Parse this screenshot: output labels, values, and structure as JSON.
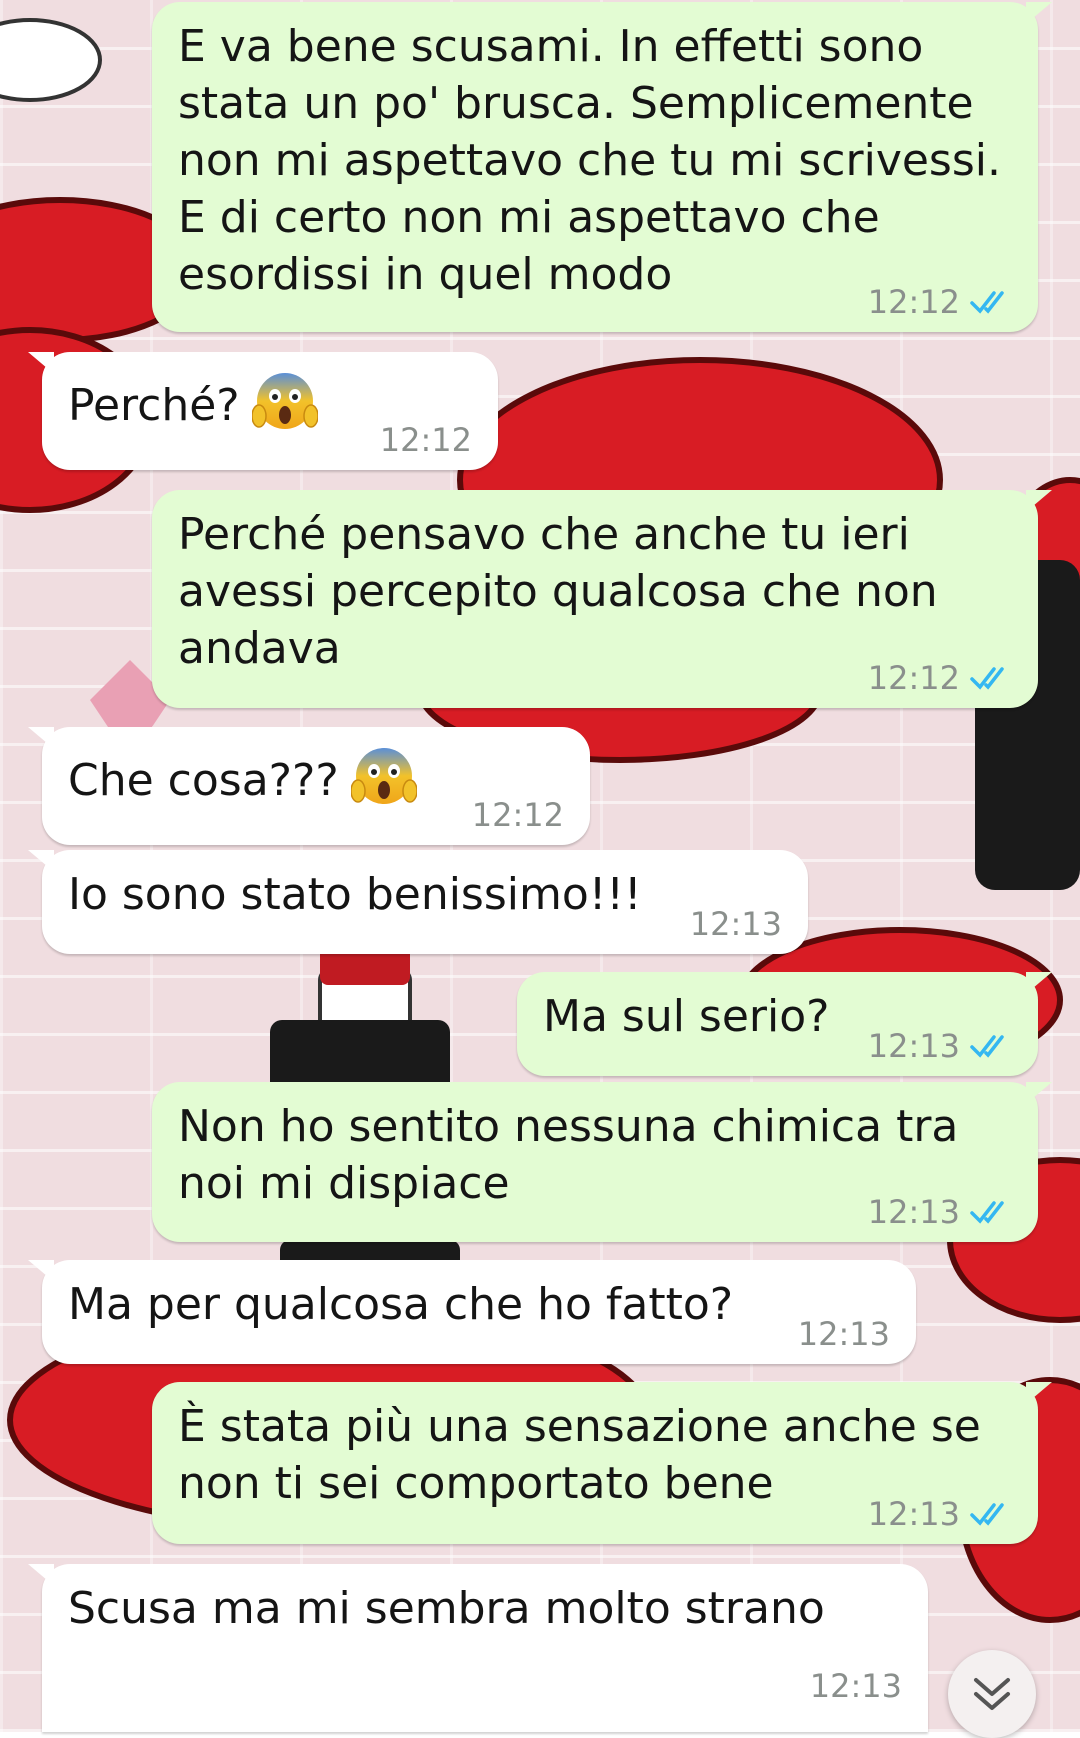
{
  "conversation": {
    "messages": [
      {
        "direction": "out",
        "text": "E va bene scusami. In effetti sono\nstata un po' brusca. Semplicemente\nnon mi aspettavo che tu mi scrivessi.\nE di certo non mi aspettavo che\nesordissi in quel modo",
        "time": "12:12",
        "status": "read"
      },
      {
        "direction": "in",
        "text": "Perché?",
        "emoji": "face-screaming-in-fear",
        "time": "12:12"
      },
      {
        "direction": "out",
        "text": "Perché pensavo che anche tu ieri\navessi percepito qualcosa che non\nandava",
        "time": "12:12",
        "status": "read"
      },
      {
        "direction": "in",
        "text": "Che cosa???",
        "emoji": "face-screaming-in-fear",
        "time": "12:12"
      },
      {
        "direction": "in",
        "text": "Io sono stato benissimo!!!",
        "time": "12:13"
      },
      {
        "direction": "out",
        "text": "Ma sul serio?",
        "time": "12:13",
        "status": "read"
      },
      {
        "direction": "out",
        "text": "Non ho sentito nessuna chimica tra\nnoi mi dispiace",
        "time": "12:13",
        "status": "read"
      },
      {
        "direction": "in",
        "text": "Ma per qualcosa che ho fatto?",
        "time": "12:13"
      },
      {
        "direction": "out",
        "text": "È stata più una sensazione anche se\nnon ti sei comportato bene",
        "time": "12:13",
        "status": "read"
      },
      {
        "direction": "in",
        "text": "Scusa ma mi sembra molto strano",
        "time": "12:13"
      }
    ]
  },
  "icons": {
    "read_receipt": "double-check-icon",
    "scroll_down": "double-chevron-down-icon",
    "emoji": "face-screaming-in-fear-emoji"
  },
  "colors": {
    "outgoing_bubble": "#e3fcd3",
    "incoming_bubble": "#ffffff",
    "read_tick": "#34b7f1",
    "wallpaper_lips": "#d81c24"
  }
}
